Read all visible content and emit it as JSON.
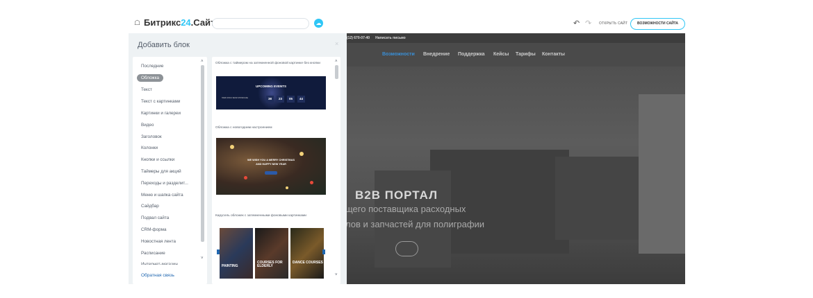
{
  "header": {
    "home_icon": "home-icon",
    "logo_prefix": "Битрикс",
    "logo_num": "24",
    "logo_suffix": ".Сайты",
    "search_value": "",
    "open_site": "ОТКРЫТЬ САЙТ",
    "features": "ВОЗМОЖНОСТИ САЙТА"
  },
  "modal": {
    "title": "Добавить блок",
    "close": "×",
    "categories": [
      "Последние",
      "Обложка",
      "Текст",
      "Текст с картинками",
      "Картинки и галереи",
      "Видео",
      "Заголовок",
      "Колонки",
      "Кнопки и ссылки",
      "Таймеры для акций",
      "Переходы и разделит...",
      "Меню и шапка сайта",
      "Сайдбар",
      "Подвал сайта",
      "CRM-форма",
      "Новостная лента",
      "Расписание",
      "Интернет-магазин"
    ],
    "active_category": "Обложка",
    "feedback": "Обратная связь",
    "blocks": [
      {
        "label": "Обложка с таймером на затемненной фоновой картинке без кнопки"
      },
      {
        "label": "Обложка с новогодним настроением"
      },
      {
        "label": "Карусель обложек с затемненными фоновыми картинками"
      }
    ],
    "thumb1": {
      "title": "UPCOMING EVENTS",
      "small": "HARD ROCK BAND SHOWCASE",
      "countdown": [
        "38",
        "23",
        "05",
        "44"
      ]
    },
    "thumb2": {
      "line1": "WE WISH YOU A MERRY CHRISTMAS",
      "line2": "AND HAPPY NEW YEAR"
    },
    "thumb3": {
      "cards": [
        "PAINTING",
        "COURSES FOR ELDERLY",
        "DANCE COURSES"
      ]
    }
  },
  "preview": {
    "phone": "(12) 670-07-40",
    "write": "Написать письмо",
    "nav": [
      "Возможности",
      "Внедрение",
      "Поддержка",
      "Кейсы",
      "Тарифы",
      "Контакты"
    ],
    "hero_title": "B2B ПОРТАЛ",
    "hero_sub1": "щего поставщика расходных",
    "hero_sub2": "лов и запчастей для полиграфии"
  }
}
